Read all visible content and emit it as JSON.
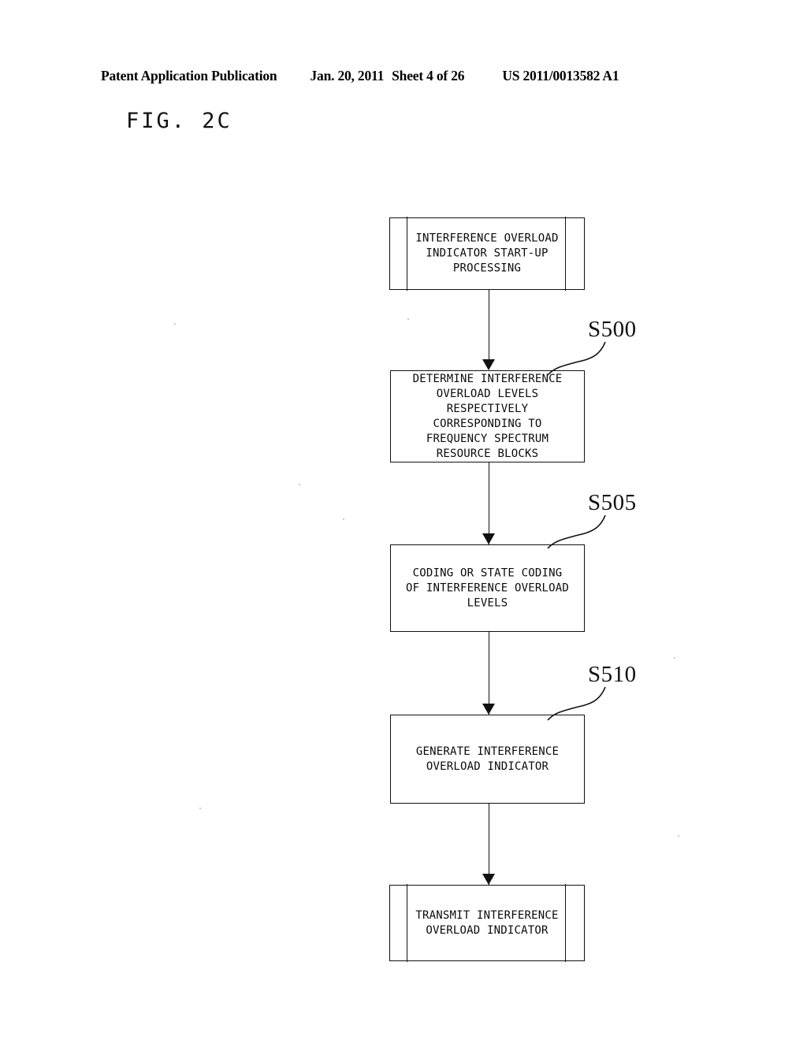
{
  "header": {
    "publication": "Patent Application Publication",
    "date": "Jan. 20, 2011",
    "sheet": "Sheet 4 of 26",
    "number": "US 2011/0013582 A1"
  },
  "figure": {
    "label": "FIG. 2C"
  },
  "flowchart": {
    "nodes": [
      {
        "id": "start",
        "shape": "predefined-process",
        "text": "INTERFERENCE OVERLOAD\nINDICATOR START-UP\nPROCESSING"
      },
      {
        "id": "determine-levels",
        "shape": "process",
        "text": "DETERMINE INTERFERENCE\nOVERLOAD LEVELS\nRESPECTIVELY\nCORRESPONDING TO\nFREQUENCY SPECTRUM\nRESOURCE BLOCKS"
      },
      {
        "id": "coding",
        "shape": "process",
        "text": "CODING OR STATE CODING\nOF INTERFERENCE OVERLOAD\nLEVELS"
      },
      {
        "id": "generate-indicator",
        "shape": "process",
        "text": "GENERATE INTERFERENCE\nOVERLOAD INDICATOR"
      },
      {
        "id": "transmit-indicator",
        "shape": "predefined-process",
        "text": "TRANSMIT INTERFERENCE\nOVERLOAD INDICATOR"
      }
    ],
    "step_labels": [
      {
        "id": "s500",
        "text": "S500"
      },
      {
        "id": "s505",
        "text": "S505"
      },
      {
        "id": "s510",
        "text": "S510"
      }
    ]
  },
  "colors": {
    "ink": "#111111",
    "paper": "#ffffff"
  }
}
